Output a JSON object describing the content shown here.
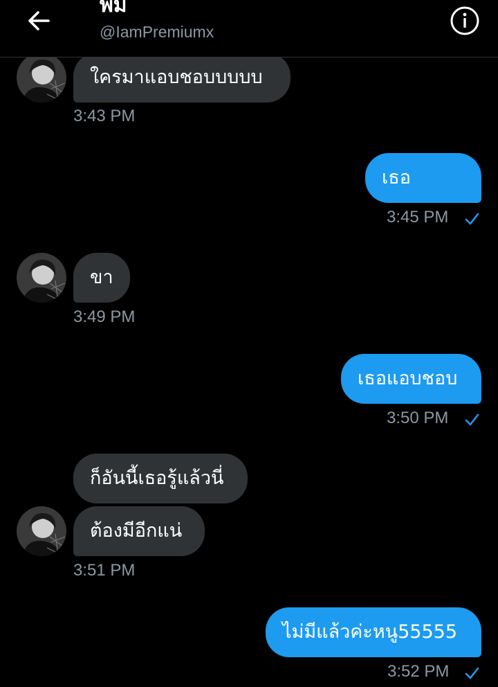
{
  "header": {
    "name": "พม",
    "handle": "@IamPremiumx",
    "back_icon": "arrow-left-icon",
    "info_icon": "info-icon"
  },
  "colors": {
    "background": "#000000",
    "incoming_bubble": "#2f3336",
    "outgoing_bubble": "#1d9bf0",
    "timestamp": "#8b98a5",
    "read_check": "#1d9bf0"
  },
  "messages": [
    {
      "direction": "in",
      "text": "ใครมาแอบชอบบบบบ",
      "time": "3:43 PM"
    },
    {
      "direction": "out",
      "text": "เธอ",
      "time": "3:45 PM",
      "read": true
    },
    {
      "direction": "in",
      "text": "ขา",
      "time": "3:49 PM"
    },
    {
      "direction": "out",
      "text": "เธอแอบชอบ",
      "time": "3:50 PM",
      "read": true
    },
    {
      "direction": "in",
      "text": "ก็อันนี้เธอรู้แล้วนี่",
      "time": ""
    },
    {
      "direction": "in",
      "text": "ต้องมีอีกแน่",
      "time": "3:51 PM"
    },
    {
      "direction": "out",
      "text": "ไม่มีแล้วค่ะหนู55555",
      "time": "3:52 PM",
      "read": true
    }
  ]
}
